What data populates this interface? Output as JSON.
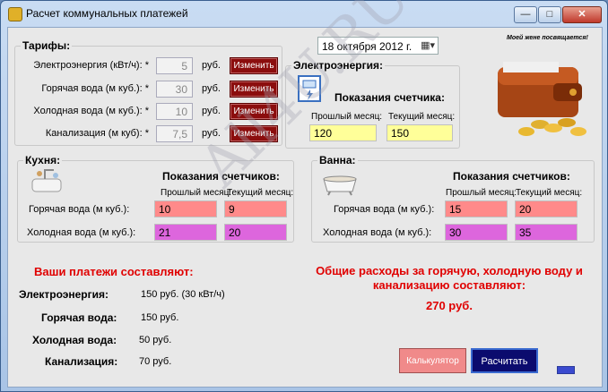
{
  "window": {
    "title": "Расчет коммунальных платежей",
    "minimize": "—",
    "maximize": "□",
    "close": "✕"
  },
  "date": {
    "value": "18  октября  2012 г."
  },
  "dedication": "Моей жене посвящается!",
  "tariffs": {
    "title": "Тарифы:",
    "rows": [
      {
        "label": "Электроэнергия (кВт/ч): *",
        "value": "5",
        "unit": "руб.",
        "button": "Изменить"
      },
      {
        "label": "Горячая вода (м куб.): *",
        "value": "30",
        "unit": "руб.",
        "button": "Изменить"
      },
      {
        "label": "Холодная вода (м куб.): *",
        "value": "10",
        "unit": "руб.",
        "button": "Изменить"
      },
      {
        "label": "Канализация (м куб): *",
        "value": "7,5",
        "unit": "руб.",
        "button": "Изменить"
      }
    ]
  },
  "electricity": {
    "title": "Электроэнергия:",
    "heading": "Показания счетчика:",
    "prev_label": "Прошлый месяц:",
    "curr_label": "Текущий месяц:",
    "prev": "120",
    "curr": "150"
  },
  "kitchen": {
    "title": "Кухня:",
    "heading": "Показания счетчиков:",
    "prev_label": "Прошлый месяц:",
    "curr_label": "Текущий месяц:",
    "hot_label": "Горячая вода (м куб.):",
    "cold_label": "Холодная вода (м куб.):",
    "hot_prev": "10",
    "hot_curr": "9",
    "cold_prev": "21",
    "cold_curr": "20"
  },
  "bath": {
    "title": "Ванна:",
    "heading": "Показания счетчиков:",
    "prev_label": "Прошлый месяц:",
    "curr_label": "Текущий месяц:",
    "hot_label": "Горячая вода (м куб.):",
    "cold_label": "Холодная вода (м куб.):",
    "hot_prev": "15",
    "hot_curr": "20",
    "cold_prev": "30",
    "cold_curr": "35"
  },
  "payments": {
    "title": "Ваши платежи составляют:",
    "rows": [
      {
        "label": "Электроэнергия:",
        "value": "150 руб. (30 кВт/ч)"
      },
      {
        "label": "Горячая вода:",
        "value": "150 руб."
      },
      {
        "label": "Холодная вода:",
        "value": "50 руб."
      },
      {
        "label": "Канализация:",
        "value": "70 руб."
      }
    ]
  },
  "total": {
    "text": "Общие расходы за горячую, холодную воду и канализацию составляют:",
    "value": "270 руб."
  },
  "buttons": {
    "calculator": "Калькулятор",
    "calculate": "Расчитать"
  },
  "watermark": "All4U.RU"
}
